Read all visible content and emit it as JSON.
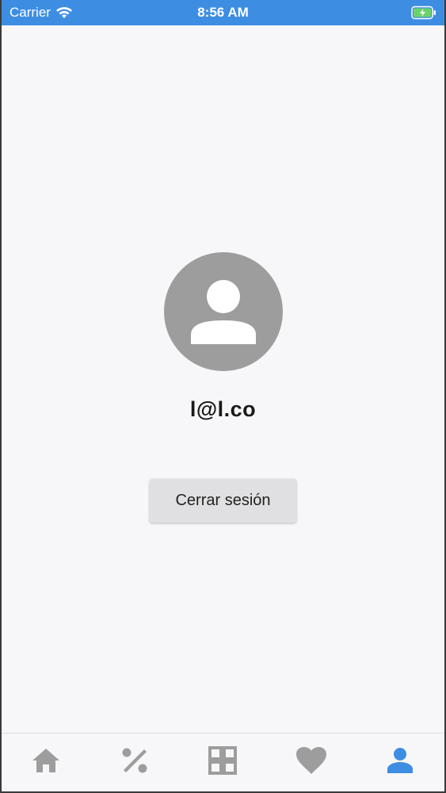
{
  "status_bar": {
    "carrier": "Carrier",
    "time": "8:56 AM",
    "background": "#3d8ee3"
  },
  "profile": {
    "avatar_icon": "account-circle-icon",
    "email": "l@l.co"
  },
  "actions": {
    "logout_label": "Cerrar sesión"
  },
  "bottom_nav": {
    "items": [
      {
        "icon": "home-icon",
        "active": false
      },
      {
        "icon": "percent-icon",
        "active": false
      },
      {
        "icon": "grid-icon",
        "active": false
      },
      {
        "icon": "heart-icon",
        "active": false
      },
      {
        "icon": "person-icon",
        "active": true
      }
    ],
    "active_color": "#3d8ee3",
    "inactive_color": "#9e9d9e"
  }
}
